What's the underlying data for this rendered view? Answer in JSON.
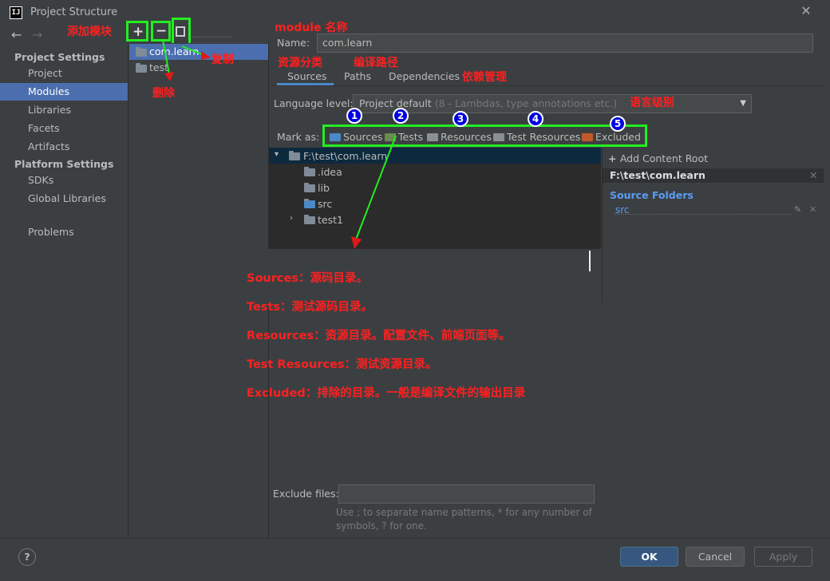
{
  "window": {
    "title": "Project Structure",
    "app_icon": "IJ"
  },
  "nav": {
    "project_settings": "Project Settings",
    "project_items": [
      "Project",
      "Modules",
      "Libraries",
      "Facets",
      "Artifacts"
    ],
    "platform_settings": "Platform Settings",
    "platform_items": [
      "SDKs",
      "Global Libraries"
    ],
    "problems": "Problems"
  },
  "modules": [
    "com.learn",
    "test"
  ],
  "main": {
    "name_label": "Name:",
    "name_value": "com.learn",
    "tabs": [
      "Sources",
      "Paths",
      "Dependencies"
    ],
    "language_level_label": "Language level:",
    "language_level_value": "Project default",
    "language_level_hint": "(8 - Lambdas, type annotations etc.)",
    "mark_as_label": "Mark as:",
    "mark_as": [
      "Sources",
      "Tests",
      "Resources",
      "Test Resources",
      "Excluded"
    ],
    "tree": {
      "root": "F:\\test\\com.learn",
      "children": [
        ".idea",
        "lib",
        "src",
        "test1"
      ]
    },
    "add_content_root": "Add Content Root",
    "content_root_path": "F:\\test\\com.learn",
    "source_folders_label": "Source Folders",
    "source_folder": "src",
    "exclude_files_label": "Exclude files:",
    "exclude_hint_1": "Use ; to separate name patterns, * for any number of",
    "exclude_hint_2": "symbols, ? for one."
  },
  "buttons": {
    "ok": "OK",
    "cancel": "Cancel",
    "apply": "Apply",
    "help": "?"
  },
  "annotations": {
    "add_module": "添加模块",
    "delete": "删除",
    "copy": "复制",
    "module_name": "module 名称",
    "resource_category": "资源分类",
    "compile_path": "编译路径",
    "dependency_mgmt": "依赖管理",
    "language_level": "语言级别",
    "badges": [
      "1",
      "2",
      "3",
      "4",
      "5"
    ],
    "explanations": [
      "Sources：源码目录。",
      "Tests：测试源码目录。",
      "Resources：资源目录。配置文件、前端页面等。",
      "Test Resources：测试资源目录。",
      "Excluded：排除的目录。一般是编译文件的输出目录"
    ]
  },
  "colors": {
    "accent_blue": "#4b6eaf",
    "annotation_red": "#ff2020",
    "annotation_green": "#22ee22",
    "source_folder": "#4a88c7",
    "test_folder": "#6a8b4e",
    "excluded_folder": "#c05a2a"
  }
}
